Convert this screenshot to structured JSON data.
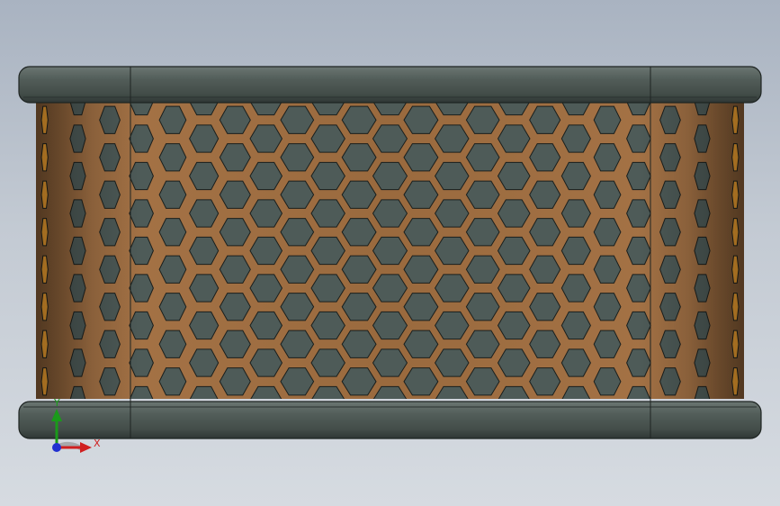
{
  "view": {
    "background_top": "#a9b3c1",
    "background_bottom": "#d6dbe1"
  },
  "model": {
    "flange_color": "#4f5a55",
    "flange_edge_color": "#1e2422",
    "mesh_color": "#9a6a3e",
    "hole_color": "#4e5b58",
    "hole_edge_color": "#1a1f1d",
    "hex_rows_visible": 13,
    "hex_columns_visible": 22
  },
  "triad": {
    "x_label": "X",
    "y_label": "Y",
    "x_color": "#d02020",
    "y_color": "#1a9a1a",
    "z_color": "#2030d0",
    "x_icon": "x-axis-arrow-icon",
    "y_icon": "y-axis-arrow-icon",
    "z_icon": "z-axis-dot-icon"
  }
}
